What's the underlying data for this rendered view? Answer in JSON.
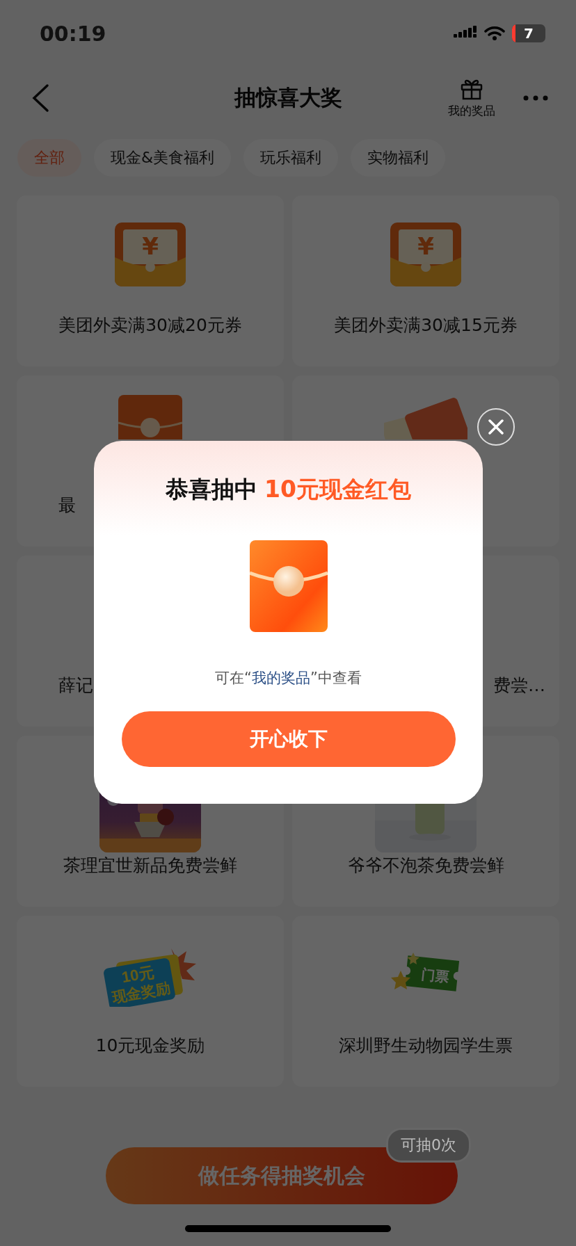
{
  "status_bar": {
    "time": "00:19",
    "battery": "7"
  },
  "nav": {
    "title": "抽惊喜大奖",
    "prizes_label": "我的奖品"
  },
  "tabs": [
    {
      "label": "全部",
      "selected": true
    },
    {
      "label": "现金&美食福利",
      "selected": false
    },
    {
      "label": "玩乐福利",
      "selected": false
    },
    {
      "label": "实物福利",
      "selected": false
    }
  ],
  "prizes": [
    {
      "title": "美团外卖满30减20元券",
      "kind": "coupon",
      "symbol": "¥"
    },
    {
      "title": "美团外卖满30减15元券",
      "kind": "coupon",
      "symbol": "¥"
    },
    {
      "title": "最",
      "kind": "envelope"
    },
    {
      "kind": "tickets"
    },
    {
      "title": "薛记",
      "kind": "hidden"
    },
    {
      "title": "费尝…",
      "kind": "hidden"
    },
    {
      "title": "茶理宜世新品免费尝鲜"
    },
    {
      "title": "爷爷不泡茶免费尝鲜"
    },
    {
      "title": "10元现金奖励",
      "kind": "cash-badge",
      "icon_lines": [
        "10元",
        "现金奖励"
      ]
    },
    {
      "title": "深圳野生动物园学生票",
      "kind": "ticket-stub",
      "icon_lines": [
        "门票"
      ]
    }
  ],
  "bottom": {
    "button": "做任务得抽奖机会",
    "badge": "可抽0次"
  },
  "dialog": {
    "title_lead": "恭喜抽中",
    "prize": "10元现金红包",
    "note_before": "可在“",
    "note_link": "我的奖品",
    "note_after": "”中查看",
    "button": "开心收下"
  }
}
